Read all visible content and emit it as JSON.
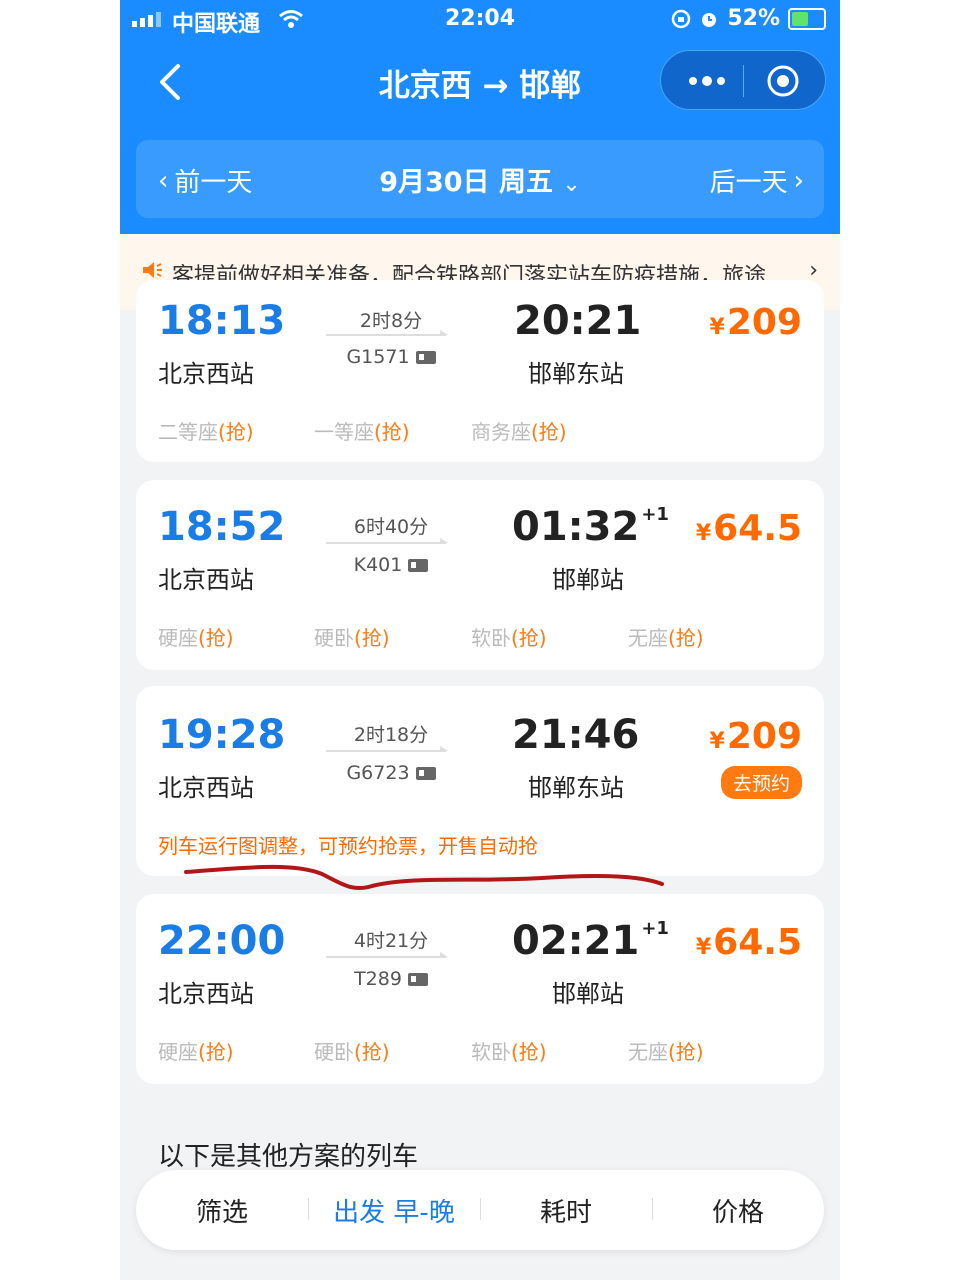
{
  "status_bar": {
    "carrier": "中国联通",
    "time": "22:04",
    "battery": "52%"
  },
  "nav": {
    "title": "北京西 → 邯郸"
  },
  "date_bar": {
    "prev": "前一天",
    "date": "9月30日 周五",
    "next": "后一天"
  },
  "notice": {
    "text": "客提前做好相关准备，配合铁路部门落实站车防疫措施，旅途"
  },
  "trains": [
    {
      "dep_time": "18:13",
      "dep_station": "北京西站",
      "duration": "2时8分",
      "train_no": "G1571",
      "arr_time": "20:21",
      "arr_station": "邯郸东站",
      "next_day": "",
      "price": "209",
      "seats": [
        {
          "name": "二等座",
          "tag": "(抢)"
        },
        {
          "name": "一等座",
          "tag": "(抢)"
        },
        {
          "name": "商务座",
          "tag": "(抢)"
        }
      ]
    },
    {
      "dep_time": "18:52",
      "dep_station": "北京西站",
      "duration": "6时40分",
      "train_no": "K401",
      "arr_time": "01:32",
      "arr_station": "邯郸站",
      "next_day": "+1",
      "price": "64.5",
      "seats": [
        {
          "name": "硬座",
          "tag": "(抢)"
        },
        {
          "name": "硬卧",
          "tag": "(抢)"
        },
        {
          "name": "软卧",
          "tag": "(抢)"
        },
        {
          "name": "无座",
          "tag": "(抢)"
        }
      ]
    },
    {
      "dep_time": "19:28",
      "dep_station": "北京西站",
      "duration": "2时18分",
      "train_no": "G6723",
      "arr_time": "21:46",
      "arr_station": "邯郸东站",
      "next_day": "",
      "price": "209",
      "badge": "去预约",
      "message": "列车运行图调整，可预约抢票，开售自动抢"
    },
    {
      "dep_time": "22:00",
      "dep_station": "北京西站",
      "duration": "4时21分",
      "train_no": "T289",
      "arr_time": "02:21",
      "arr_station": "邯郸站",
      "next_day": "+1",
      "price": "64.5",
      "seats": [
        {
          "name": "硬座",
          "tag": "(抢)"
        },
        {
          "name": "硬卧",
          "tag": "(抢)"
        },
        {
          "name": "软卧",
          "tag": "(抢)"
        },
        {
          "name": "无座",
          "tag": "(抢)"
        }
      ]
    }
  ],
  "currency": "¥",
  "section_title": "以下是其他方案的列车",
  "tabs": [
    "筛选",
    "出发 早-晚",
    "耗时",
    "价格"
  ],
  "colors": {
    "primary": "#1a8cff",
    "price": "#ff6a00",
    "annotation": "#b01818"
  }
}
